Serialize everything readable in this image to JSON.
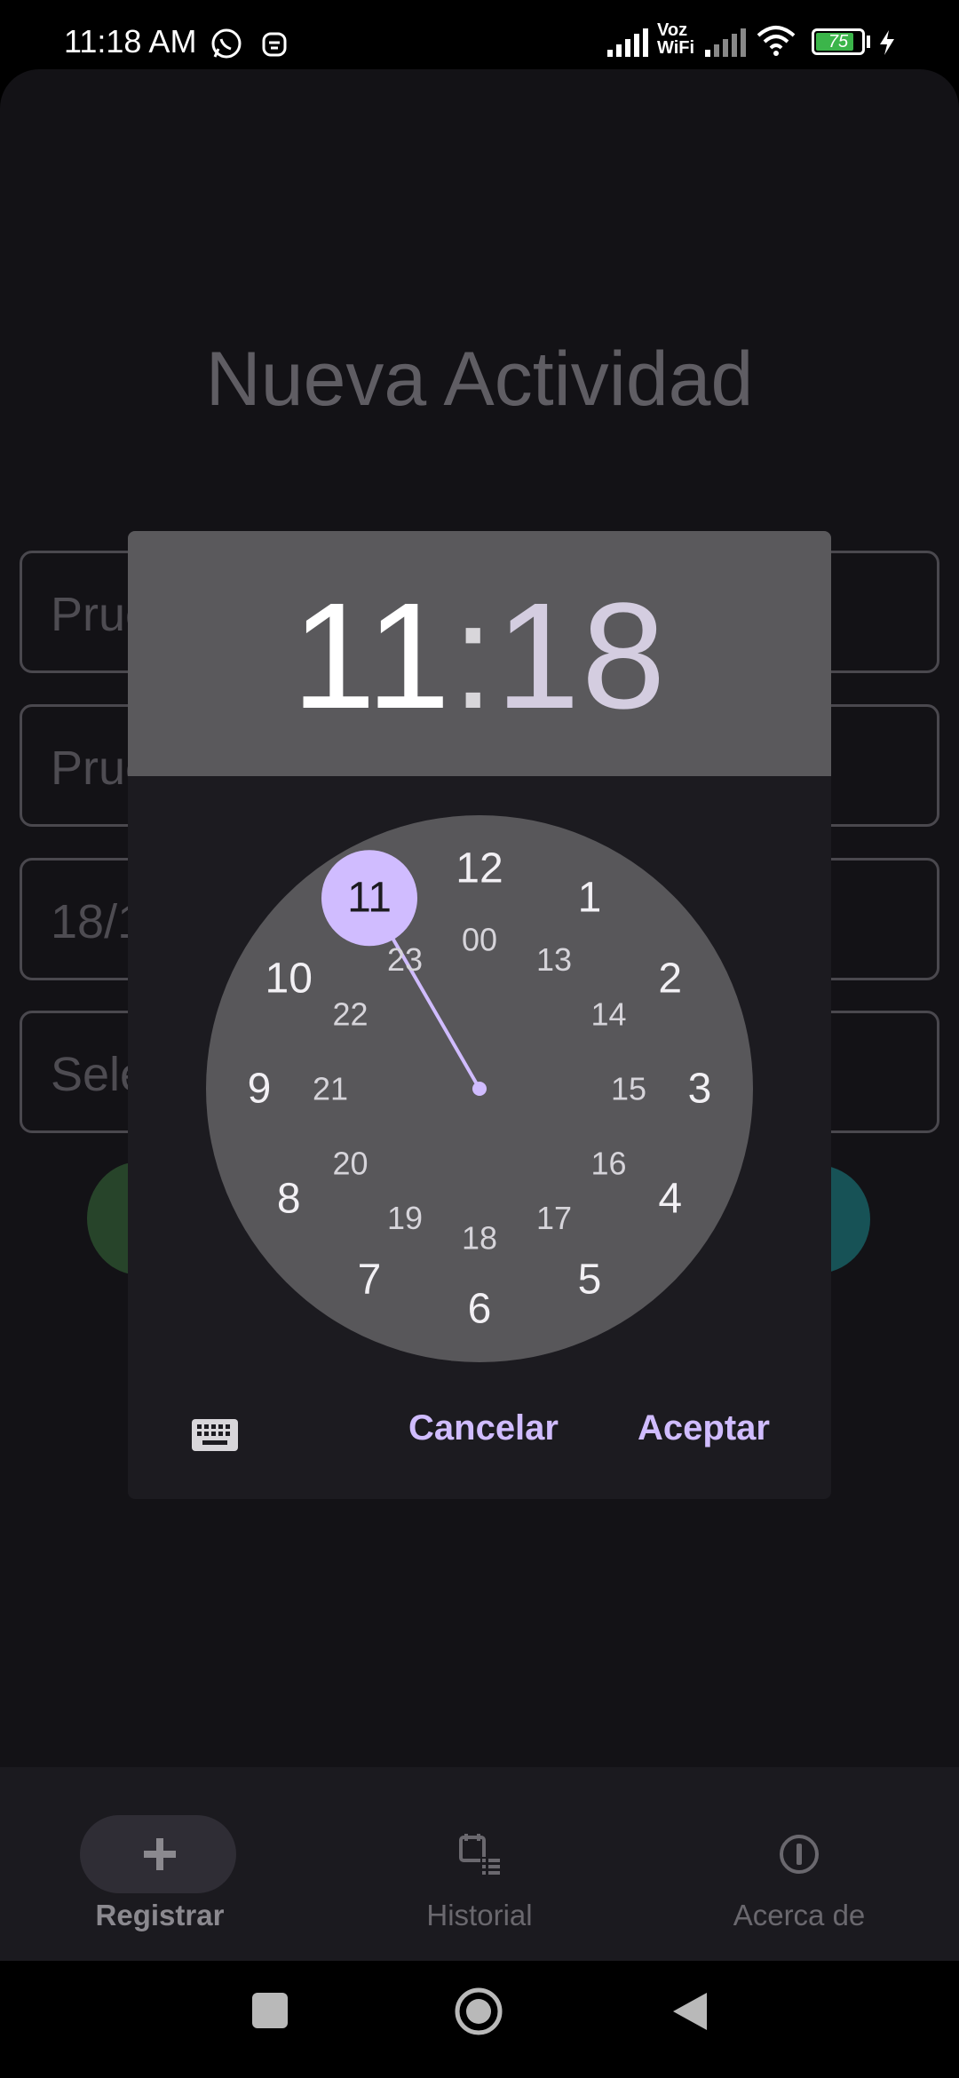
{
  "status_bar": {
    "time": "11:18 AM",
    "network_label_top": "Voz",
    "network_label_bottom": "WiFi",
    "battery": "75"
  },
  "page": {
    "title": "Nueva Actividad",
    "fields": [
      {
        "value": "Pruc"
      },
      {
        "value": "Pruc"
      },
      {
        "value": "18/1"
      },
      {
        "value": "Sele"
      }
    ]
  },
  "time_picker": {
    "hours": "11",
    "separator": ":",
    "minutes": "18",
    "selected_hour": "11",
    "outer_numbers": [
      "12",
      "1",
      "2",
      "3",
      "4",
      "5",
      "6",
      "7",
      "8",
      "9",
      "10",
      "11"
    ],
    "inner_numbers": [
      "00",
      "13",
      "14",
      "15",
      "16",
      "17",
      "18",
      "19",
      "20",
      "21",
      "22",
      "23"
    ],
    "cancel_label": "Cancelar",
    "accept_label": "Aceptar",
    "accent_color": "#d0bcff"
  },
  "bottom_nav": {
    "items": [
      {
        "label": "Registrar",
        "icon": "plus-icon",
        "active": true
      },
      {
        "label": "Historial",
        "icon": "calendar-list-icon",
        "active": false
      },
      {
        "label": "Acerca de",
        "icon": "info-circle-icon",
        "active": false
      }
    ]
  }
}
